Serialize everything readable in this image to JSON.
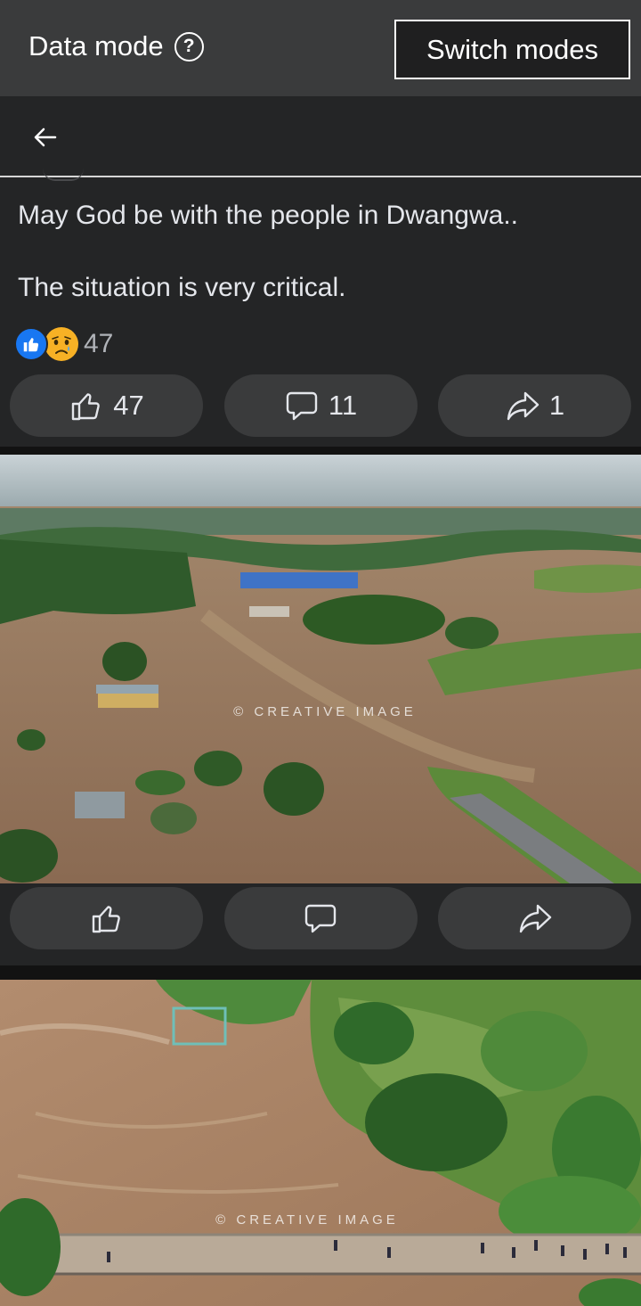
{
  "banner": {
    "title": "Data mode",
    "help_icon": "question-circle-icon",
    "switch_label": "Switch modes"
  },
  "header": {
    "back_icon": "arrow-left-icon"
  },
  "post": {
    "text_line1": "May God be with the people in Dwangwa..",
    "text_line2": "The situation is very critical.",
    "reaction_icons": [
      "like-reaction-icon",
      "sad-reaction-icon"
    ],
    "reaction_count": "47",
    "actions": {
      "like_count": "47",
      "comment_count": "11",
      "share_count": "1"
    }
  },
  "photos": [
    {
      "watermark": "© CREATIVE IMAGE",
      "description_icon": "flood-town-photo"
    },
    {
      "watermark": "© CREATIVE IMAGE",
      "description_icon": "flood-bridge-photo"
    }
  ],
  "colors": {
    "banner_bg": "#3a3b3c",
    "surface": "#242526",
    "pill": "#3a3b3c",
    "text": "#e4e6eb",
    "muted": "#b0b3b8",
    "like_blue": "#1877f2",
    "sad_yellow": "#f7b125"
  }
}
